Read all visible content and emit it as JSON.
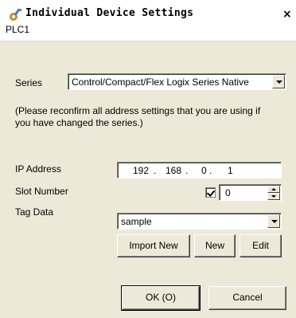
{
  "window": {
    "title": "Individual Device Settings",
    "close_glyph": "×",
    "icon": "settings-icon"
  },
  "device_name": "PLC1",
  "series": {
    "label": "Series",
    "value": "Control/Compact/Flex Logix Series Native"
  },
  "note": "(Please reconfirm all address settings that you are using if you have changed the series.)",
  "ip": {
    "label": "IP Address",
    "seg1": "192",
    "seg2": "168",
    "seg3": "0",
    "seg4": "1"
  },
  "slot": {
    "label": "Slot Number",
    "checked": true,
    "value": "0"
  },
  "tag": {
    "label": "Tag Data",
    "value": "sample"
  },
  "buttons": {
    "import_new": "Import New",
    "new": "New",
    "edit": "Edit",
    "ok": "OK (O)",
    "cancel": "Cancel"
  }
}
